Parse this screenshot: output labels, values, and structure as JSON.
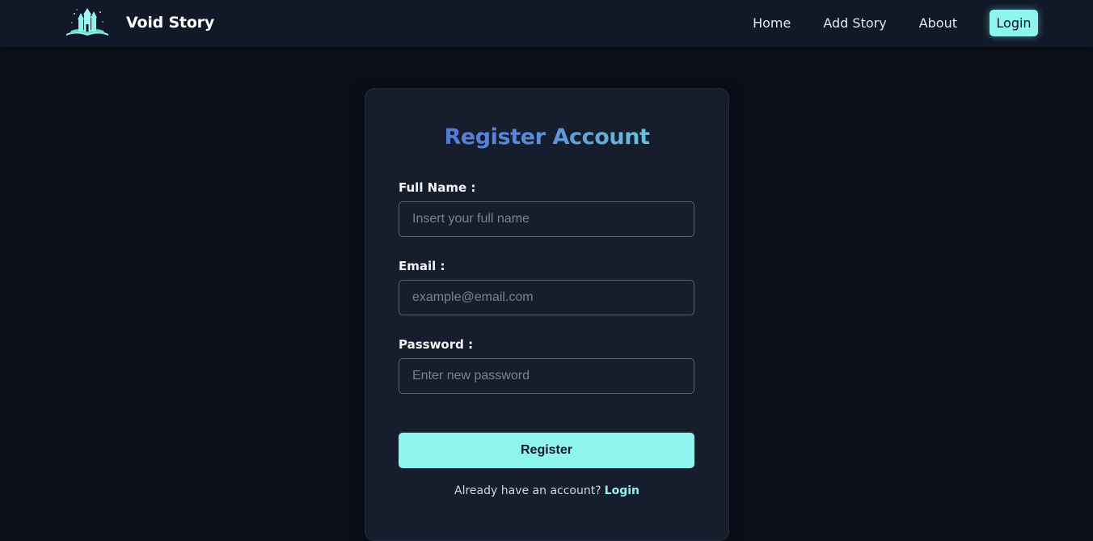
{
  "brand": {
    "name": "Void Story",
    "logo_icon": "castle-book-icon"
  },
  "nav": {
    "items": [
      {
        "label": "Home"
      },
      {
        "label": "Add Story"
      },
      {
        "label": "About"
      }
    ],
    "login_label": "Login"
  },
  "form": {
    "title": "Register Account",
    "fields": [
      {
        "label": "Full Name :",
        "placeholder": "Insert your full name",
        "value": ""
      },
      {
        "label": "Email :",
        "placeholder": "example@email.com",
        "value": ""
      },
      {
        "label": "Password :",
        "placeholder": "Enter new password",
        "value": ""
      }
    ],
    "submit_label": "Register",
    "footer_text": "Already have an account?",
    "footer_link": "Login"
  },
  "colors": {
    "accent": "#8df5ee",
    "page_background": "#0b0f1a",
    "navbar_background": "#111827",
    "card_background": "#161e2e",
    "title_gradient_start": "#4f6ed6",
    "title_gradient_end": "#72e6e3"
  }
}
